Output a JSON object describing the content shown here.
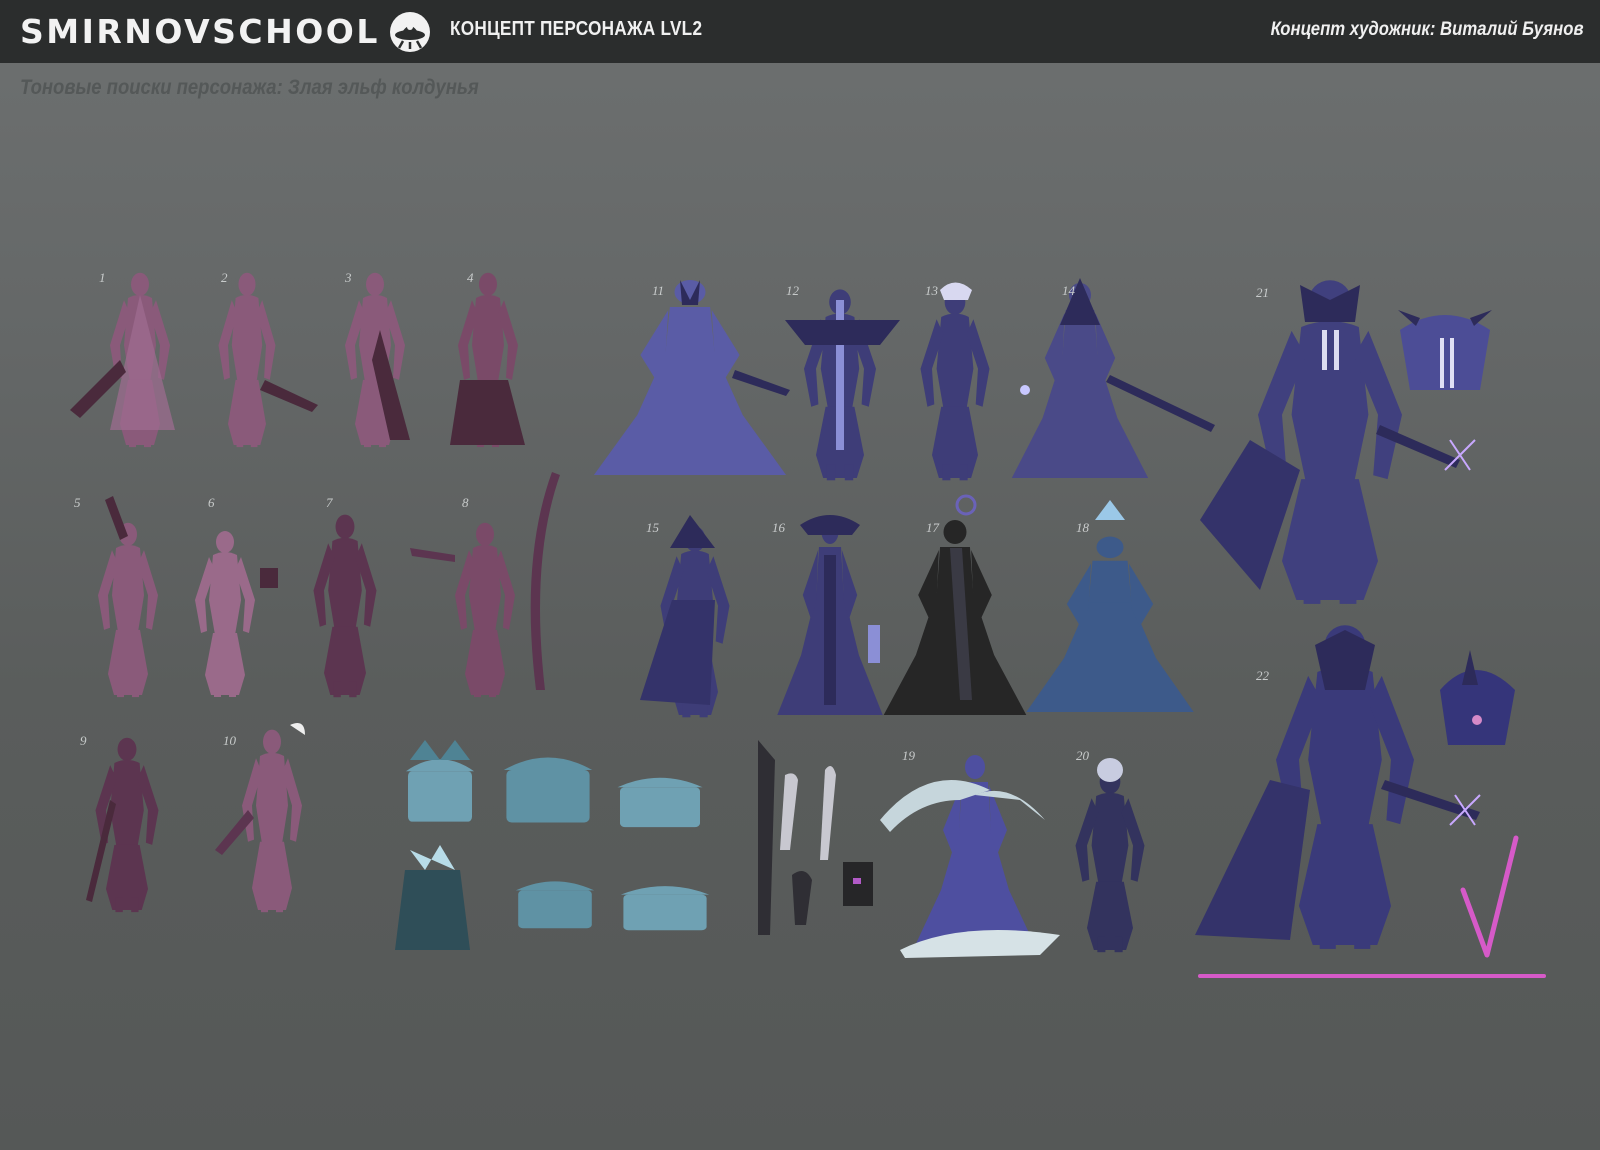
{
  "header": {
    "logo_text": "SMIRNOVSCHOOL",
    "subtitle": "КОНЦЕПТ ПЕРСОНАЖА LVL2",
    "artist": "Концепт художник: Виталий Буянов"
  },
  "page_title": "Тоновые поиски персонажа: Злая эльф колдунья",
  "figure_numbers": [
    "1",
    "2",
    "3",
    "4",
    "5",
    "6",
    "7",
    "8",
    "9",
    "10",
    "11",
    "12",
    "13",
    "14",
    "15",
    "16",
    "17",
    "18",
    "19",
    "20",
    "21",
    "22"
  ],
  "colors": {
    "header_bg": "#2b2d2d",
    "magenta_group": "#8a5a7a",
    "magenta_dark": "#4a2a3c",
    "blue_group": "#3e3d78",
    "blue_light": "#5a5ca6",
    "chest_teal": "#6fa1b3",
    "approval_mark": "#d65ac8"
  }
}
